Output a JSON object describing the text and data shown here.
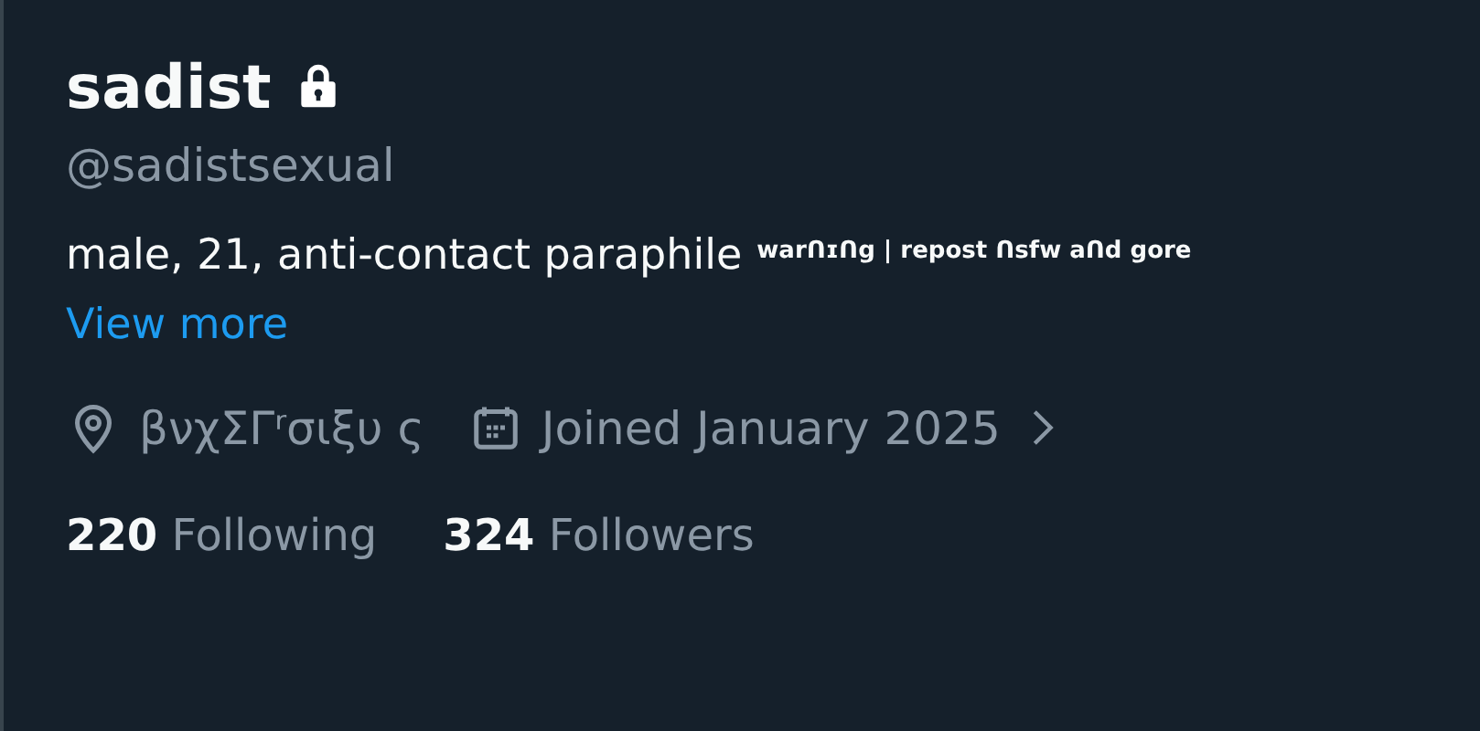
{
  "profile": {
    "name": "sadist",
    "protected": true,
    "handle": "@sadistsexual",
    "bio": "male, 21, anti-contact paraphile",
    "bio_note": "warᑎɪᑎg | repost ᑎsfw aᑎd gore",
    "view_more": "View more",
    "location": "βνχΣΓʳσιξυ ς",
    "joined": "Joined January 2025"
  },
  "stats": [
    {
      "count": "220",
      "label": "Following"
    },
    {
      "count": "324",
      "label": "Followers"
    }
  ]
}
